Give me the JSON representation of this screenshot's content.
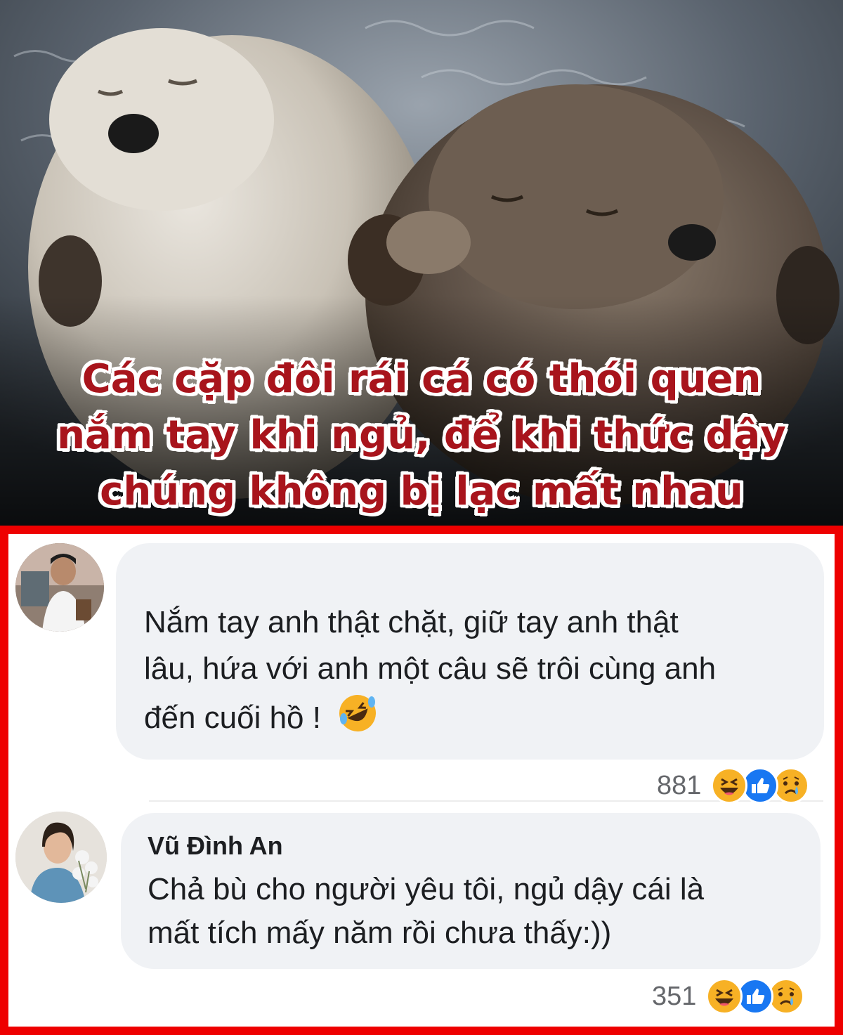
{
  "headline": {
    "line1": "Các cặp đôi rái cá có thói quen",
    "line2": "nắm tay khi ngủ, để khi thức dậy",
    "line3": "chúng không bị lạc mất nhau",
    "color": "#a8141c"
  },
  "comments": [
    {
      "author": "",
      "text_line1": "Nắm tay anh thật chặt, giữ tay anh thật",
      "text_line2": "lâu, hứa với anh một câu sẽ trôi cùng anh",
      "text_line3": "đến cuối hồ !",
      "emoji_inline": "🤣",
      "reaction_count": "881",
      "reactions": [
        "haha-icon",
        "like-icon",
        "sad-icon"
      ]
    },
    {
      "author": "Vũ Đình An",
      "text_line1": "Chả bù cho người yêu tôi, ngủ dậy cái là",
      "text_line2": "mất tích mấy năm rồi chưa thấy:))",
      "reaction_count": "351",
      "reactions": [
        "haha-icon",
        "like-icon",
        "sad-icon"
      ]
    }
  ],
  "colors": {
    "panel_border": "#ee0000",
    "bubble": "#f0f2f5",
    "like": "#1877f2",
    "haha": "#f7b125"
  }
}
